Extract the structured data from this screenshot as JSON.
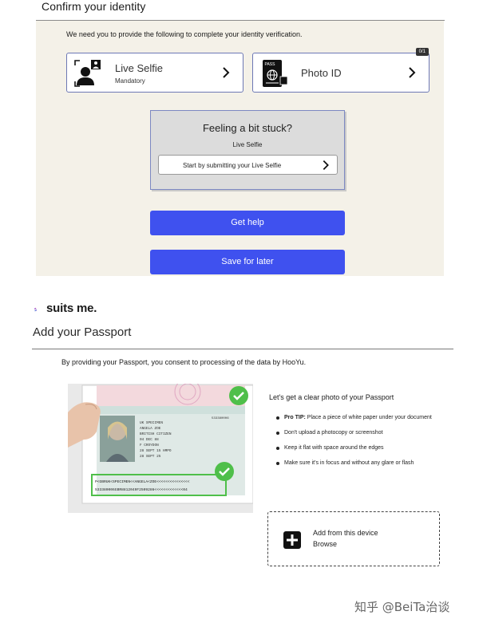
{
  "identity": {
    "title": "Confirm your identity",
    "intro": "We need you to provide the following to complete your identity verification.",
    "selfie_card": {
      "title": "Live Selfie",
      "subtitle": "Mandatory"
    },
    "photo_card": {
      "title": "Photo ID",
      "count": "0/1"
    },
    "stuck": {
      "heading": "Feeling a bit stuck?",
      "subheading": "Live Selfie",
      "button": "Start by submitting your Live Selfie"
    },
    "help_button": "Get help",
    "save_button": "Save for later"
  },
  "passport": {
    "logo_text": "suits me.",
    "title": "Add your Passport",
    "consent": "By providing your Passport, you consent to processing of the data by HooYu.",
    "tips_heading": "Let's get a clear photo of your Passport",
    "tips": [
      {
        "bold": "Pro TIP:",
        "text": " Place a piece of white paper under your document"
      },
      {
        "bold": "",
        "text": "Don't upload a photocopy or screenshot"
      },
      {
        "bold": "",
        "text": "Keep it flat with space around the edges"
      },
      {
        "bold": "",
        "text": "Make sure it's in focus and without any glare or flash"
      }
    ],
    "upload": {
      "line1": "Add from this device",
      "line2": "Browse"
    },
    "sample_image": {
      "mrz_line1": "P<GBRUK<SPECIMEN<<ANGELA<ZOE<<<<<<<<<<<<<<<",
      "mrz_line2": "533380006GBR8812049F2509286<<<<<<<<<<<<<04",
      "fields": [
        "UK SPECIMEN",
        "ANGELA ZOE",
        "BRITISH CITIZEN",
        "04 DEC 88",
        "F  CROYDON",
        "28 SEPT 15  HMPO",
        "28 SEPT 25"
      ],
      "doc_number": "533380006"
    }
  },
  "watermark": "知乎 @BeiTa治谈",
  "colors": {
    "primary": "#3f51ef",
    "panel": "#f4f1e8",
    "check_green": "#4fbf4a"
  }
}
